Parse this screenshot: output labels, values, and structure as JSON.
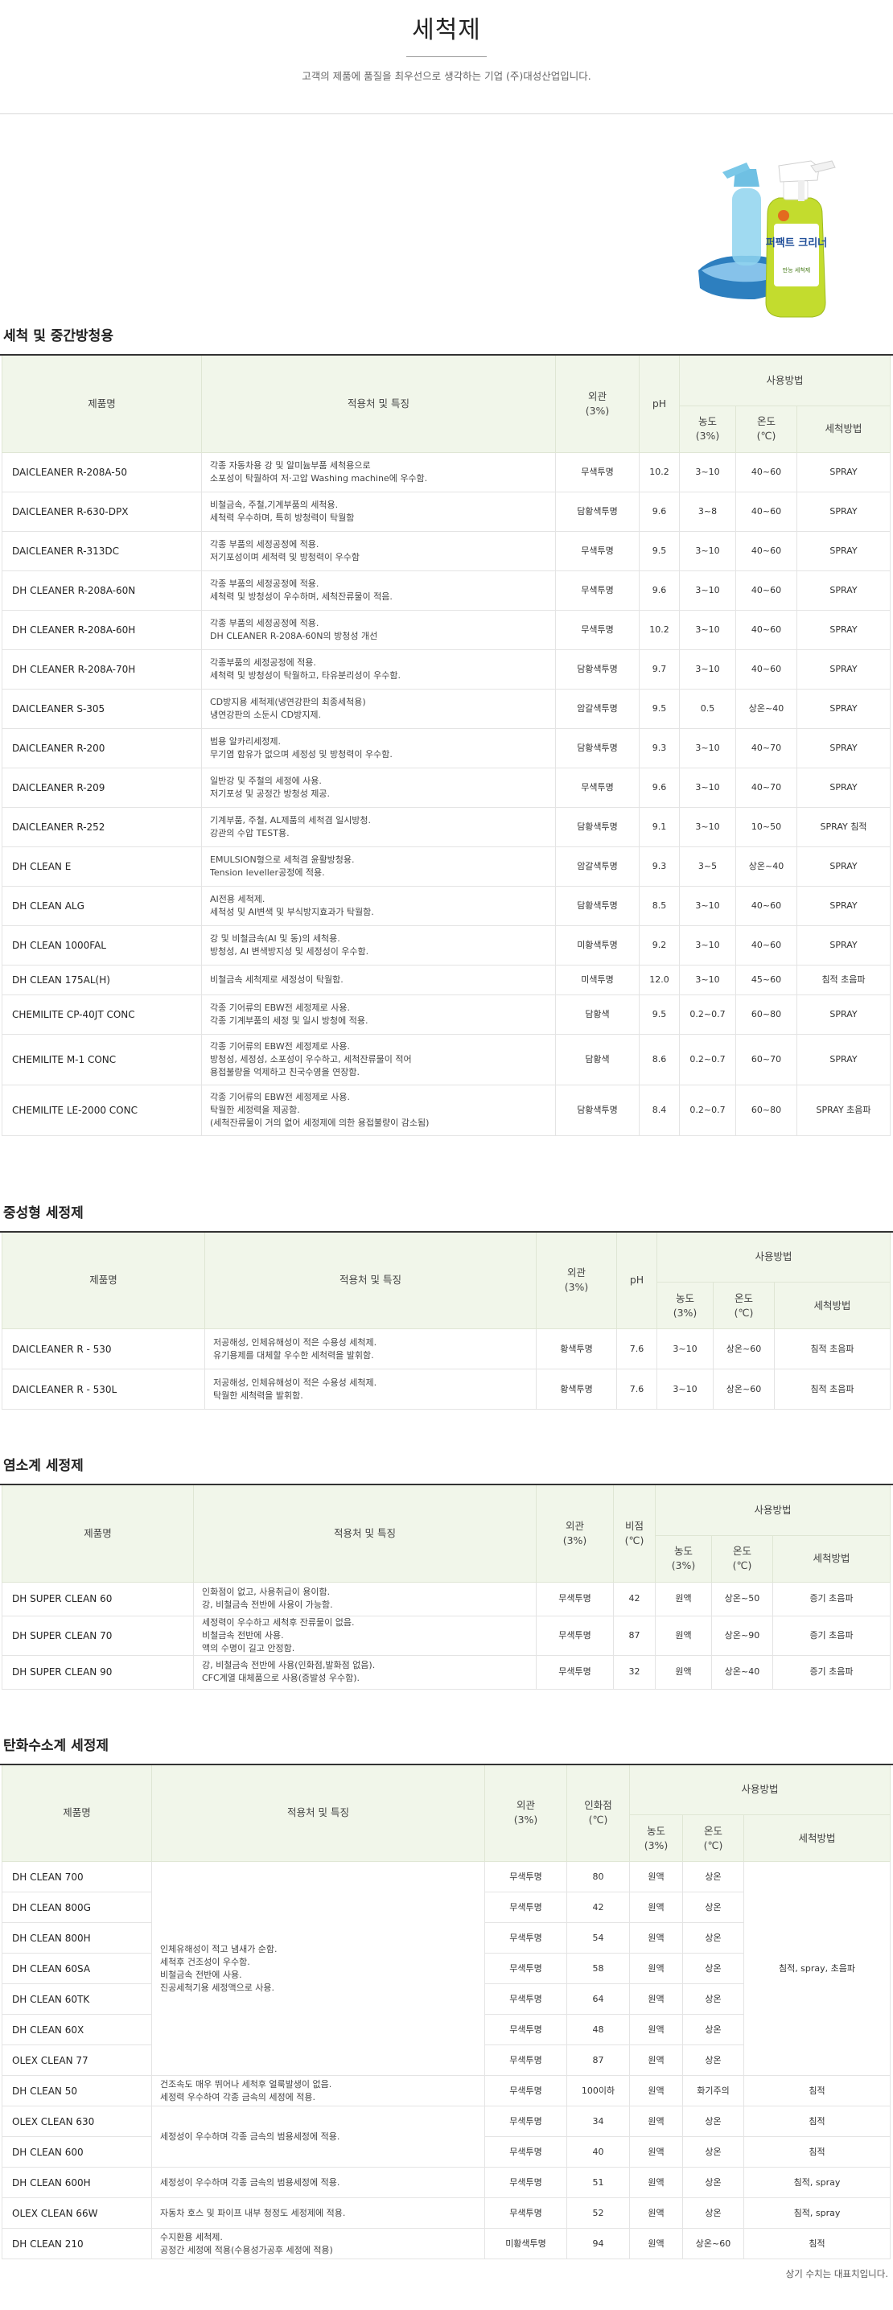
{
  "header": {
    "title": "세척제",
    "subtitle": "고객의 제품에 품질을 최우선으로 생각하는 기업 (주)대성산업입니다."
  },
  "hero": {
    "bottle_label": "퍼팩트 크리너",
    "bottle_sublabel": "만능 세척제"
  },
  "colors": {
    "header_bg": "#f1f6ea",
    "border": "#e4e4e4",
    "rule": "#333333"
  },
  "usage_label": "사용방법",
  "sections": [
    {
      "title": "세척 및 중간방청용",
      "headers": [
        "제품명",
        "적용처 및 특징",
        "외관\n(3%)",
        "pH",
        "농도\n(3%)",
        "온도\n(℃)",
        "세척방법"
      ],
      "rows": [
        [
          "DAICLEANER R-208A-50",
          "각종 자동차용 강 및 알미늄부품 세척용으로\n소포성이 탁월하여 저·고압 Washing machine에 우수함.",
          "무색투명",
          "10.2",
          "3~10",
          "40~60",
          "SPRAY"
        ],
        [
          "DAICLEANER R-630-DPX",
          "비철금속, 주철,기계부품의 세척용.\n세척력 우수하며, 특히 방청력이 탁월함",
          "담황색투명",
          "9.6",
          "3~8",
          "40~60",
          "SPRAY"
        ],
        [
          "DAICLEANER R-313DC",
          "각종 부품의 세정공정에 적용.\n저기포성이며 세척력 및 방청력이 우수함",
          "무색투명",
          "9.5",
          "3~10",
          "40~60",
          "SPRAY"
        ],
        [
          "DH CLEANER R-208A-60N",
          "각종 부품의 세정공정에 적용.\n세척력 및 방청성이 우수하며, 세척잔류물이 적음.",
          "무색투명",
          "9.6",
          "3~10",
          "40~60",
          "SPRAY"
        ],
        [
          "DH CLEANER R-208A-60H",
          "각종 부품의 세정공정에 적용.\nDH CLEANER R-208A-60N의 방청성 개선",
          "무색투명",
          "10.2",
          "3~10",
          "40~60",
          "SPRAY"
        ],
        [
          "DH CLEANER R-208A-70H",
          "각종부품의 세정공정에 적용.\n세척력 및 방청성이 탁월하고, 타유분리성이 우수함.",
          "담황색투명",
          "9.7",
          "3~10",
          "40~60",
          "SPRAY"
        ],
        [
          "DAICLEANER S-305",
          "CD방지용 세척제(냉연강판의 최종세척용)\n냉연강판의 소둔시 CD방지제.",
          "암갈색투명",
          "9.5",
          "0.5",
          "상온~40",
          "SPRAY"
        ],
        [
          "DAICLEANER R-200",
          "범용 알카리세정제.\n무기염 함유가 없으며 세정성 및 방청력이 우수함.",
          "담황색투명",
          "9.3",
          "3~10",
          "40~70",
          "SPRAY"
        ],
        [
          "DAICLEANER R-209",
          "일반강 및 주철의 세정에 사용.\n저기포성 및 공정간 방청성 제공.",
          "무색투명",
          "9.6",
          "3~10",
          "40~70",
          "SPRAY"
        ],
        [
          "DAICLEANER R-252",
          "기계부품, 주철, AL제품의 세척겸 일시방청.\n강관의 수압 TEST용.",
          "담황색투명",
          "9.1",
          "3~10",
          "10~50",
          "SPRAY 침적"
        ],
        [
          "DH CLEAN E",
          "EMULSION형으로 세척겸 윤활방청용.\nTension leveller공정에 적용.",
          "암갈색투명",
          "9.3",
          "3~5",
          "상온~40",
          "SPRAY"
        ],
        [
          "DH CLEAN ALG",
          "AI전용 세척제.\n세척성 및 AI변색 및 부식방지효과가 탁월함.",
          "담황색투명",
          "8.5",
          "3~10",
          "40~60",
          "SPRAY"
        ],
        [
          "DH CLEAN 1000FAL",
          "강 및 비철금속(AI 및 동)의 세척용.\n방청성, AI 변색방지성 및 세정성이 우수함.",
          "미황색투명",
          "9.2",
          "3~10",
          "40~60",
          "SPRAY"
        ],
        [
          "DH CLEAN 175AL(H)",
          "비철금속 세척제로 세정성이 탁월함.",
          "미색투명",
          "12.0",
          "3~10",
          "45~60",
          "침적 초음파"
        ],
        [
          "CHEMILITE CP-40JT CONC",
          "각종 기어류의 EBW전 세정제로 사용.\n각종 기계부품의 세정 및 일시 방청에 적용.",
          "담황색",
          "9.5",
          "0.2~0.7",
          "60~80",
          "SPRAY"
        ],
        [
          "CHEMILITE M-1 CONC",
          "각종 기어류의 EBW전 세정제로 사용.\n방청성, 세정성, 소포성이 우수하고, 세척잔류물이 적어\n용접불량을 억제하고 친국수영을 연장함.",
          "담황색",
          "8.6",
          "0.2~0.7",
          "60~70",
          "SPRAY"
        ],
        [
          "CHEMILITE LE-2000 CONC",
          "각종 기어류의 EBW전 세정제로 사용.\n탁월한 세정력을 제공함.\n(세척잔류물이 거의 없어 세정제에 의한 용접불량이 감소됨)",
          "담황색투명",
          "8.4",
          "0.2~0.7",
          "60~80",
          "SPRAY 초음파"
        ]
      ]
    },
    {
      "title": "중성형 세정제",
      "headers": [
        "제품명",
        "적용처 및 특징",
        "외관\n(3%)",
        "pH",
        "농도\n(3%)",
        "온도\n(℃)",
        "세척방법"
      ],
      "rows": [
        [
          "DAICLEANER R - 530",
          "저공해성, 인체유해성이 적은 수용성 세척제.\n유기용제를 대체할 우수한 세척력을 발휘함.",
          "황색투명",
          "7.6",
          "3~10",
          "상온~60",
          "침적 초음파"
        ],
        [
          "DAICLEANER R - 530L",
          "저공해성, 인체유해성이 적은 수용성 세척제.\n탁월한 세척력을 발휘함.",
          "황색투명",
          "7.6",
          "3~10",
          "상온~60",
          "침적 초음파"
        ]
      ]
    },
    {
      "title": "염소계 세정제",
      "headers": [
        "제품명",
        "적용처 및 특징",
        "외관\n(3%)",
        "비점\n(℃)",
        "농도\n(3%)",
        "온도\n(℃)",
        "세척방법"
      ],
      "rows": [
        [
          "DH SUPER CLEAN 60",
          "인화점이 없고, 사용취급이 용이함.\n강, 비철금속 전반에 사용이 가능함.",
          "무색투명",
          "42",
          "원액",
          "상온~50",
          "증기 초음파"
        ],
        [
          "DH SUPER CLEAN 70",
          "세정력이 우수하고 세척후 잔류물이 없음.\n비철금속 전반에 사용.\n액의 수명이 길고 안정함.",
          "무색투명",
          "87",
          "원액",
          "상온~90",
          "증기 초음파"
        ],
        [
          "DH SUPER CLEAN 90",
          "강, 비철금속 전반에 사용(인화점,발화점 없음).\nCFC계열 대체품으로 사용(증발성 우수함).",
          "무색투명",
          "32",
          "원액",
          "상온~40",
          "증기 초음파"
        ]
      ]
    },
    {
      "title": "탄화수소계 세정제",
      "headers": [
        "제품명",
        "적용처 및 특징",
        "외관\n(3%)",
        "인화점\n(℃)",
        "농도\n(3%)",
        "온도\n(℃)",
        "세척방법"
      ],
      "rows": [
        [
          "DH CLEAN 700",
          "인체유해성이 적고 냄새가 순함.\n세척후 건조성이 우수함.\n비철금속 전반에 사용.\n진공세척기용 세정액으로 사용.",
          "무색투명",
          "80",
          "원액",
          "상온",
          "침적, spray, 초음파"
        ],
        [
          "DH CLEAN 800G",
          "",
          "무색투명",
          "42",
          "원액",
          "상온",
          ""
        ],
        [
          "DH CLEAN 800H",
          "",
          "무색투명",
          "54",
          "원액",
          "상온",
          ""
        ],
        [
          "DH CLEAN 60SA",
          "",
          "무색투명",
          "58",
          "원액",
          "상온",
          ""
        ],
        [
          "DH CLEAN 60TK",
          "",
          "무색투명",
          "64",
          "원액",
          "상온",
          ""
        ],
        [
          "DH CLEAN 60X",
          "",
          "무색투명",
          "48",
          "원액",
          "상온",
          ""
        ],
        [
          "OLEX CLEAN 77",
          "",
          "무색투명",
          "87",
          "원액",
          "상온",
          ""
        ],
        [
          "DH CLEAN 50",
          "건조속도 매우 뛰어나 세척후 얼룩발생이 없음.\n세정력 우수하여 각종 금속의 세정에 적용.",
          "무색투명",
          "100이하",
          "원액",
          "화기주의",
          "침적"
        ],
        [
          "OLEX CLEAN 630",
          "세정성이 우수하며 각종 금속의 범용세정에 적용.",
          "무색투명",
          "34",
          "원액",
          "상온",
          "침적"
        ],
        [
          "DH CLEAN 600",
          "",
          "무색투명",
          "40",
          "원액",
          "상온",
          "침적"
        ],
        [
          "DH CLEAN 600H",
          "세정성이 우수하며 각종 금속의 범용세정에 적용.",
          "무색투명",
          "51",
          "원액",
          "상온",
          "침적, spray"
        ],
        [
          "OLEX CLEAN 66W",
          "자동차 호스 및 파이프 내부 청정도 세정제에 적용.",
          "무색투명",
          "52",
          "원액",
          "상온",
          "침적, spray"
        ],
        [
          "DH CLEAN 210",
          "수지환용 세척제.\n공정간 세정에 적용(수용성가공후 세정에 적용)",
          "미황색투명",
          "94",
          "원액",
          "상온~60",
          "침적"
        ]
      ]
    }
  ],
  "footnote": "상기 수치는 대표치입니다."
}
